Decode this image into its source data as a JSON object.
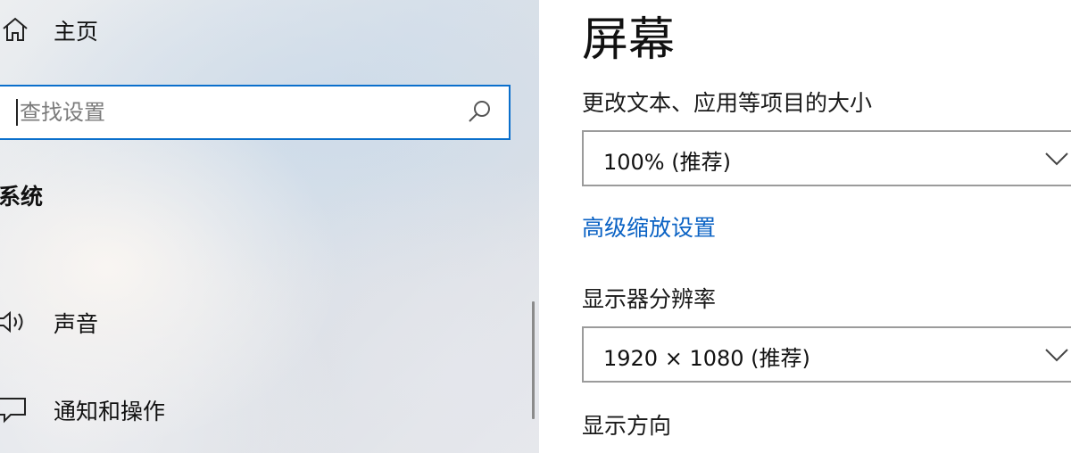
{
  "sidebar": {
    "home": {
      "label": "主页",
      "icon": "home-icon"
    },
    "search": {
      "placeholder": "查找设置",
      "icon": "search-icon"
    },
    "section_title": "系统",
    "items": [
      {
        "label": "声音",
        "icon": "speaker-icon"
      },
      {
        "label": "通知和操作",
        "icon": "notification-icon"
      }
    ]
  },
  "main": {
    "title": "屏幕",
    "scale": {
      "label": "更改文本、应用等项目的大小",
      "value": "100% (推荐)"
    },
    "advanced_link": "高级缩放设置",
    "resolution": {
      "label": "显示器分辨率",
      "value": "1920 × 1080 (推荐)"
    },
    "orientation": {
      "label": "显示方向"
    }
  },
  "colors": {
    "accent": "#0a6fcc",
    "link": "#0a62c4"
  }
}
